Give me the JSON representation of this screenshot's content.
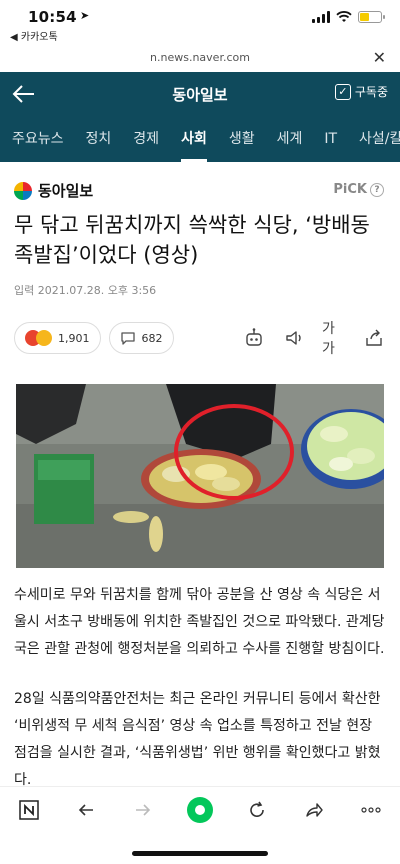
{
  "status": {
    "time": "10:54",
    "back_app": "◀ 카카오톡"
  },
  "url": "n.news.naver.com",
  "header": {
    "title": "동아일보",
    "subscribe_label": "구독중"
  },
  "nav": {
    "tabs": [
      "주요뉴스",
      "정치",
      "경제",
      "사회",
      "생활",
      "세계",
      "IT",
      "사설/칼럼"
    ],
    "active": "사회"
  },
  "article": {
    "press_name": "동아일보",
    "pick_label": "PiCK",
    "headline": "무 닦고 뒤꿈치까지 쓱싹한 식당, ‘방배동 족발집’이었다 (영상)",
    "date": "입력 2021.07.28. 오후 3:56",
    "reaction_count": "1,901",
    "comment_count": "682",
    "font_size_label": "가가",
    "paragraph1": "수세미로 무와 뒤꿈치를 함께 닦아 공분을 산 영상 속 식당은 서울시 서초구 방배동에 위치한 족발집인 것으로 파악됐다. 관계당국은 관할 관청에 행정처분을 의뢰하고 수사를 진행할 방침이다.",
    "paragraph2": "28일 식품의약품안전처는 최근 온라인 커뮤니티 등에서 확산한 ‘비위생적 무 세척 음식점’ 영상 속 업소를 특정하고 전날 현장 점검을 실시한 결과, ‘식품위생법’ 위반 행위를 확인했다고 밝혔다."
  },
  "colors": {
    "header_bg": "#0f4a5c",
    "highlight_circle": "#e0202a",
    "naver_green": "#03c75a"
  }
}
